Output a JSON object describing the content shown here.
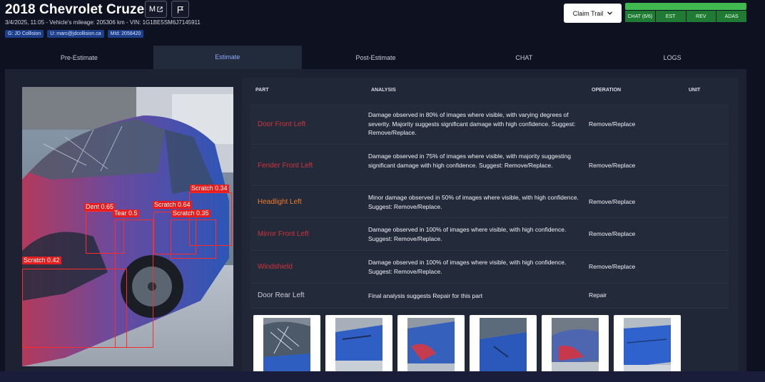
{
  "header": {
    "title": "2018 Chevrolet Cruze",
    "m_button_label": "M",
    "meta_line": "3/4/2025, 11:05 - Vehicle's mileage: 205306 km - VIN: 1G1BE5SM6J7145911",
    "badges": [
      "G: JD Collision",
      "U: marc@jdcollision.ca",
      "MId: 2058420"
    ],
    "claim_trail_label": "Claim Trail",
    "stages": [
      "CHAT (6/6)",
      "EST",
      "REV",
      "ADAS"
    ]
  },
  "tabs": [
    "Pre-Estimate",
    "Estimate",
    "Post-Estimate",
    "CHAT",
    "LOGS"
  ],
  "active_tab": "Estimate",
  "detections": [
    {
      "label": "Scratch 0.34"
    },
    {
      "label": "Dent 0.65"
    },
    {
      "label": "Scratch 0.64"
    },
    {
      "label": "Tear 0.5"
    },
    {
      "label": "Scratch 0.35"
    },
    {
      "label": "Scratch 0.42"
    }
  ],
  "table": {
    "columns": [
      "PART",
      "ANALYSIS",
      "OPERATION",
      "UNIT"
    ],
    "rows": [
      {
        "part": "Door Front Left",
        "analysis": "Damage observed in 80% of images where visible, with varying degrees of severity. Majority suggests significant damage with high confidence. Suggest: Remove/Replace.",
        "operation": "Remove/Replace",
        "unit": ""
      },
      {
        "part": "Fender Front Left",
        "analysis": "Damage observed in 75% of images where visible, with majority suggesting significant damage with high confidence. Suggest: Remove/Replace.",
        "operation": "Remove/Replace",
        "unit": ""
      },
      {
        "part": "Headlight Left",
        "analysis": "Minor damage observed in 50% of images where visible, with high confidence. Suggest: Remove/Replace.",
        "operation": "Remove/Replace",
        "unit": ""
      },
      {
        "part": "Mirror Front Left",
        "analysis": "Damage observed in 100% of images where visible, with high confidence. Suggest: Remove/Replace.",
        "operation": "Remove/Replace",
        "unit": ""
      },
      {
        "part": "Windshield",
        "analysis": "Damage observed in 100% of images where visible, with high confidence. Suggest: Remove/Replace.",
        "operation": "Remove/Replace",
        "unit": ""
      },
      {
        "part": "Door Rear Left",
        "analysis": "Final analysis suggests Repair for this part",
        "operation": "Repair",
        "unit": ""
      }
    ]
  },
  "colors": {
    "accent": "#8fa6ff",
    "part_severe": "#d0333a",
    "part_minor": "#f07a2a",
    "stage_done": "#3fb950",
    "detection": "#e81e1e"
  }
}
